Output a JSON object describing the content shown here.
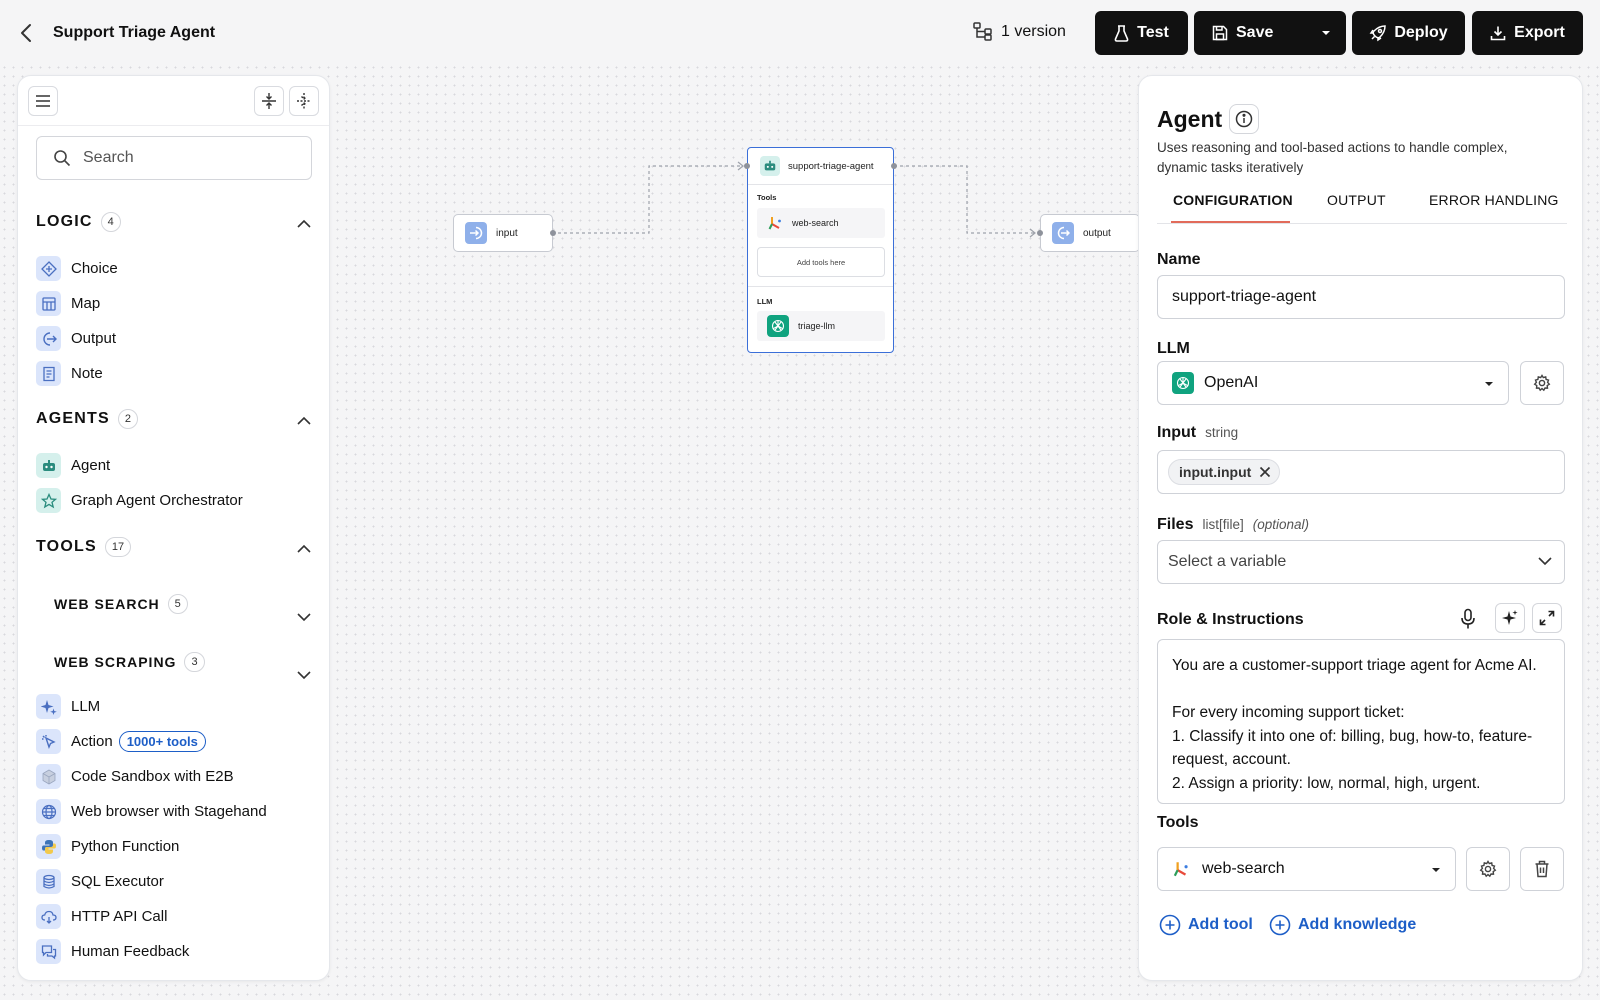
{
  "header": {
    "title": "Support Triage Agent",
    "version_label": "1 version",
    "test_label": "Test",
    "save_label": "Save",
    "deploy_label": "Deploy",
    "export_label": "Export"
  },
  "left_panel": {
    "search_placeholder": "Search",
    "sections": {
      "logic": {
        "title": "LOGIC",
        "count": "4",
        "items": [
          "Choice",
          "Map",
          "Output",
          "Note"
        ]
      },
      "agents": {
        "title": "AGENTS",
        "count": "2",
        "items": [
          "Agent",
          "Graph Agent Orchestrator"
        ]
      },
      "tools": {
        "title": "TOOLS",
        "count": "17",
        "subsections": [
          {
            "title": "WEB SEARCH",
            "count": "5"
          },
          {
            "title": "WEB SCRAPING",
            "count": "3"
          }
        ],
        "items": [
          "LLM",
          "Action",
          "Code Sandbox with E2B",
          "Web browser with Stagehand",
          "Python Function",
          "SQL Executor",
          "HTTP API Call",
          "Human Feedback"
        ],
        "action_badge": "1000+ tools"
      }
    }
  },
  "canvas": {
    "input_node": "input",
    "output_node": "output",
    "agent_node": {
      "title": "support-triage-agent",
      "tools_label": "Tools",
      "tool": "web-search",
      "add_tools": "Add tools here",
      "llm_label": "LLM",
      "llm": "triage-llm"
    }
  },
  "right_panel": {
    "title": "Agent",
    "description": "Uses reasoning and tool-based actions to handle complex, dynamic tasks iteratively",
    "tabs": [
      "CONFIGURATION",
      "OUTPUT",
      "ERROR HANDLING"
    ],
    "name_label": "Name",
    "name_value": "support-triage-agent",
    "llm_label": "LLM",
    "llm_value": "OpenAI",
    "input_label": "Input",
    "input_type": "string",
    "input_chip": "input.input",
    "files_label": "Files",
    "files_type": "list[file]",
    "files_optional": "(optional)",
    "files_placeholder": "Select a variable",
    "role_label": "Role & Instructions",
    "role_text": "You are a customer-support triage agent for Acme AI.\n\nFor every incoming support ticket:\n1. Classify it into one of: billing, bug, how-to, feature-request, account.\n2. Assign a priority: low, normal, high, urgent.",
    "tools_label": "Tools",
    "tool_value": "web-search",
    "add_tool": "Add tool",
    "add_knowledge": "Add knowledge"
  },
  "colors": {
    "accent_blue": "#1d5ec7",
    "selection_blue": "#3b6fd8",
    "tab_underline": "#e26b5a",
    "openai_green": "#10a37f",
    "dark_button": "#111111"
  }
}
